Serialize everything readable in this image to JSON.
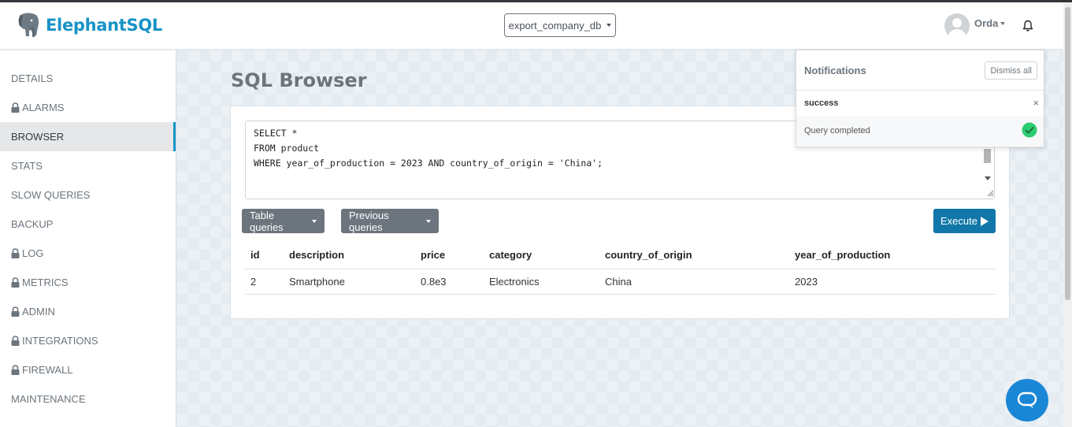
{
  "app": {
    "brand": "ElephantSQL"
  },
  "header": {
    "database_selector": "export_company_db",
    "user_name": "Orda"
  },
  "sidebar": {
    "items": [
      {
        "label": "DETAILS",
        "locked": false,
        "active": false
      },
      {
        "label": "ALARMS",
        "locked": true,
        "active": false
      },
      {
        "label": "BROWSER",
        "locked": false,
        "active": true
      },
      {
        "label": "STATS",
        "locked": false,
        "active": false
      },
      {
        "label": "SLOW QUERIES",
        "locked": false,
        "active": false
      },
      {
        "label": "BACKUP",
        "locked": false,
        "active": false
      },
      {
        "label": "LOG",
        "locked": true,
        "active": false
      },
      {
        "label": "METRICS",
        "locked": true,
        "active": false
      },
      {
        "label": "ADMIN",
        "locked": true,
        "active": false
      },
      {
        "label": "INTEGRATIONS",
        "locked": true,
        "active": false
      },
      {
        "label": "FIREWALL",
        "locked": true,
        "active": false
      },
      {
        "label": "MAINTENANCE",
        "locked": false,
        "active": false
      }
    ]
  },
  "main": {
    "title": "SQL Browser",
    "query": "SELECT *\nFROM product\nWHERE year_of_production = 2023 AND country_of_origin = 'China';",
    "buttons": {
      "table_queries": "Table queries",
      "previous_queries": "Previous queries",
      "execute": "Execute"
    },
    "results": {
      "columns": [
        "id",
        "description",
        "price",
        "category",
        "country_of_origin",
        "year_of_production"
      ],
      "rows": [
        [
          "2",
          "Smartphone",
          "0.8e3",
          "Electronics",
          "China",
          "2023"
        ]
      ]
    }
  },
  "notifications": {
    "title": "Notifications",
    "dismiss_all": "Dismiss all",
    "items": [
      {
        "title": "success",
        "message": "Query completed",
        "close": "×"
      }
    ]
  },
  "colors": {
    "brand": "#1793c6",
    "execute_button": "#1177a8",
    "secondary_button": "#6c757d",
    "success": "#2ecc71",
    "chat_button": "#1a87d6"
  }
}
